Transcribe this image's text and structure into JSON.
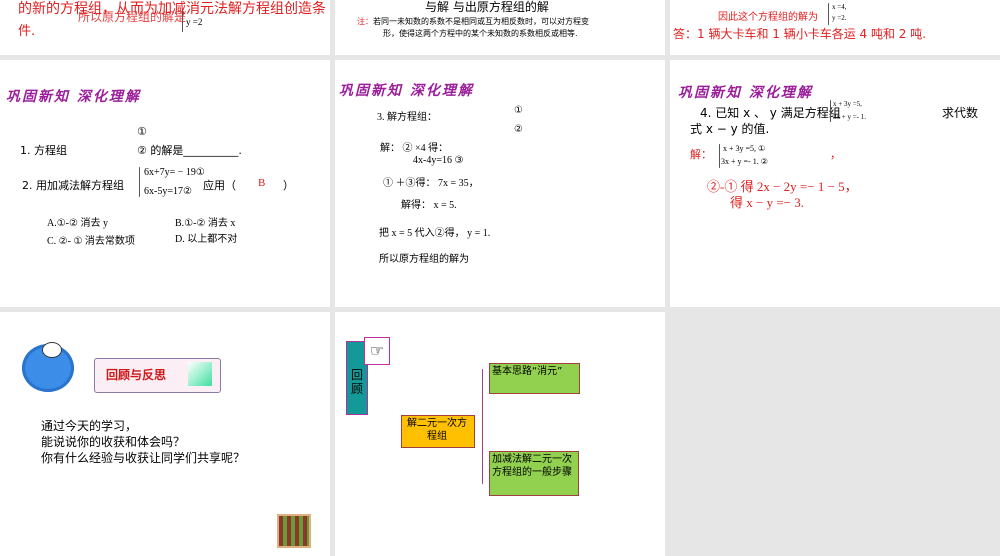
{
  "slides": [
    {
      "red_line1": "的新的方程组，从而为加减消元法解方程组创造条",
      "red_line2": "件.",
      "overlay": "所以原方程组的解是",
      "eq": "y =2"
    },
    {
      "top_cut": "与解            与出原方程组的解",
      "note_label": "注：",
      "note_line1": "若同一未知数的系数不是相同或互为相反数时，可以对方程变",
      "note_line2": "形，使得这两个方程中的某个未知数的系数相反或相等."
    },
    {
      "line": "因此这个方程组的解为",
      "eq1": "x =4,",
      "eq2": "y =2.",
      "answer": "答：1 辆大卡车和 1 辆小卡车各运 4 吨和 2 吨."
    },
    {
      "title": "巩固新知 深化理解",
      "q1_label": "1. 方程组",
      "q1_c1": "①",
      "q1_c2": "② 的解是__________.",
      "q2_label": "2. 用加减法解方程组",
      "q2_eq1": "6x+7y= − 19①",
      "q2_eq2": "6x-5y=17②",
      "q2_apply": "应用（",
      "q2_answer": "B",
      "q2_close": "）",
      "optA": "A.①-② 消去 y",
      "optB": "B.①-② 消去 x",
      "optC": "C. ②- ① 消去常数项",
      "optD": "D. 以上都不对"
    },
    {
      "title": "巩固新知 深化理解",
      "q3": "3. 解方程组：",
      "c1": "①",
      "c2": "②",
      "s1": "解： ② ×4 得：",
      "s2": "4x-4y=16 ③",
      "s3": "① ＋③得： 7x = 35，",
      "s4": "解得： x = 5.",
      "s5": "把 x = 5 代入②得， y = 1.",
      "s6": "所以原方程组的解为"
    },
    {
      "title": "巩固新知 深化理解",
      "q4a": "4. 已知 x 、 y 满足方程组",
      "q4eq1": "x + 3y =5,",
      "q4eq2": "3x + y =- 1.",
      "q4b": "求代数",
      "q4c": "式 x − y 的值.",
      "sol": "解：",
      "seq1": "x + 3y =5,  ①",
      "seq2": "3x + y =- 1.  ②",
      "comma": "，",
      "r1": "②-① 得 2x − 2y =− 1 − 5，",
      "r2": "得 x − y =− 3."
    },
    {
      "banner": "回顾与反思",
      "l1": "通过今天的学习，",
      "l2": "能说说你的收获和体会吗？",
      "l3": "你有什么经验与收获让同学们共享呢？"
    },
    {
      "side": "回顾",
      "hand": "☞",
      "center": "解二元一次方程组",
      "b1": "基本思路“消元”",
      "b2": "加减法解二元一次方程组的一般步骤"
    }
  ]
}
